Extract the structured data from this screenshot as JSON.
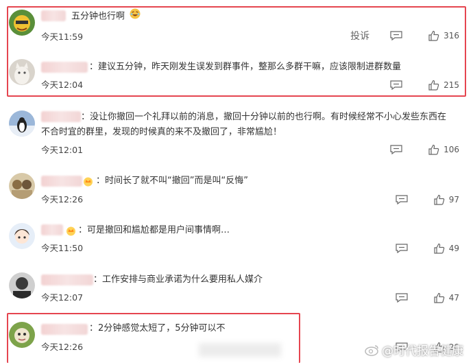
{
  "comments": [
    {
      "text": "五分钟也行啊",
      "time": "今天11:59",
      "report_label": "投诉",
      "likes": "316"
    },
    {
      "prefix": "：",
      "text": "建议五分钟，昨天刚发生误发到群事件，整那么多群干嘛，应该限制进群数量",
      "time": "今天12:04",
      "likes": "215"
    },
    {
      "prefix": "：",
      "text_line1": "没让你撤回一个礼拜以前的消息，撤回十分钟以前的也行啊。有时候经常不小心发些东西在",
      "text_line2": "不合时宜的群里，发现的时候真的来不及撤回了，非常尴尬！",
      "time": "今天12:01",
      "likes": "106"
    },
    {
      "prefix": "：",
      "text": "时间长了就不叫“撤回”而是叫“反悔”",
      "time": "今天12:26",
      "likes": "97"
    },
    {
      "prefix": "：",
      "text": "可是撤回和尴尬都是用户间事情啊…",
      "time": "今天11:50",
      "likes": "49"
    },
    {
      "prefix": "：",
      "text": "工作安排与商业承诺为什么要用私人媒介",
      "time": "今天12:07",
      "likes": "47"
    },
    {
      "prefix": "：",
      "text": "2分钟感觉太短了，5分钟可以不",
      "time": "今天12:26",
      "likes": "20"
    }
  ],
  "watermark": {
    "text": "@时代报告健康"
  },
  "colors": {
    "highlight_box": "#e5454f",
    "text": "#333333",
    "meta": "#555555"
  }
}
